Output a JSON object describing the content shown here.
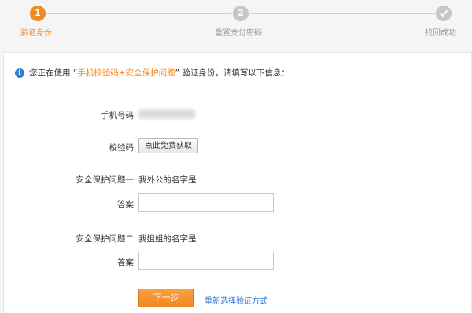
{
  "steps": [
    {
      "number": "1",
      "label": "验证身份",
      "state": "active"
    },
    {
      "number": "2",
      "label": "重置支付密码",
      "state": "todo"
    },
    {
      "number": "",
      "label": "找回成功",
      "state": "todo",
      "icon": "check-icon"
    }
  ],
  "notice": {
    "icon": "info-icon",
    "prefix": "您正在使用 “",
    "highlight": "手机校验码+安全保护问题",
    "suffix": "” 验证身份，请填写以下信息："
  },
  "form": {
    "phone_label": "手机号码",
    "code_label": "校验码",
    "code_button": "点此免费获取",
    "question1_label": "安全保护问题一",
    "question1_text": "我外公的名字是",
    "answer1_label": "答案",
    "answer1_value": "",
    "question2_label": "安全保护问题二",
    "question2_text": "我姐姐的名字是",
    "answer2_label": "答案",
    "answer2_value": ""
  },
  "actions": {
    "next_label": "下一步",
    "reselect_label": "重新选择验证方式"
  },
  "colors": {
    "accent": "#f08a24",
    "link": "#2e6fd1",
    "info": "#2e7fd3"
  }
}
